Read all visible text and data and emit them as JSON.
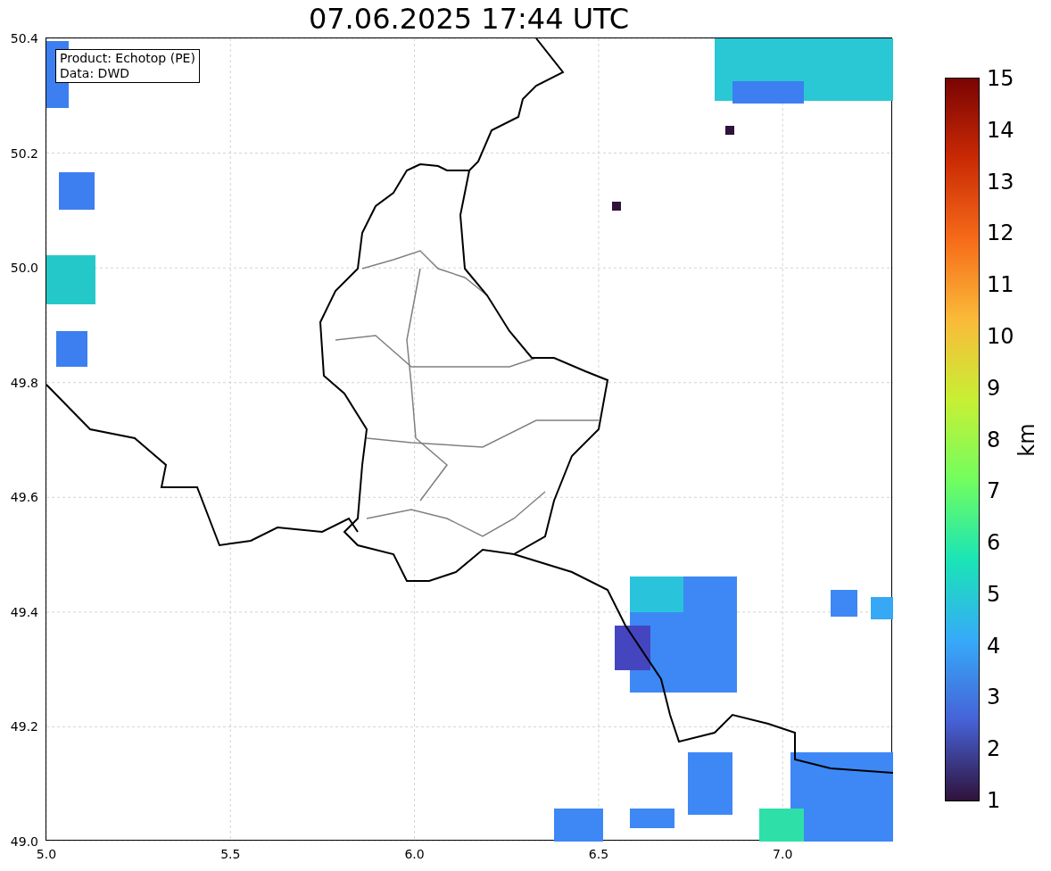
{
  "title": "07.06.2025 17:44 UTC",
  "map": {
    "legend": [
      "Product: Echotop (PE)",
      "Data: DWD"
    ]
  },
  "y_ticks": [
    "50.4",
    "50.2",
    "50.0",
    "49.8",
    "49.6",
    "49.4",
    "49.2",
    "49.0"
  ],
  "x_ticks": [
    "5.0",
    "5.5",
    "6.0",
    "6.5",
    "7.0"
  ],
  "colorbar": {
    "label": "km",
    "ticks": [
      "15",
      "14",
      "13",
      "12",
      "11",
      "10",
      "9",
      "8",
      "7",
      "6",
      "5",
      "4",
      "3",
      "2",
      "1"
    ]
  }
}
